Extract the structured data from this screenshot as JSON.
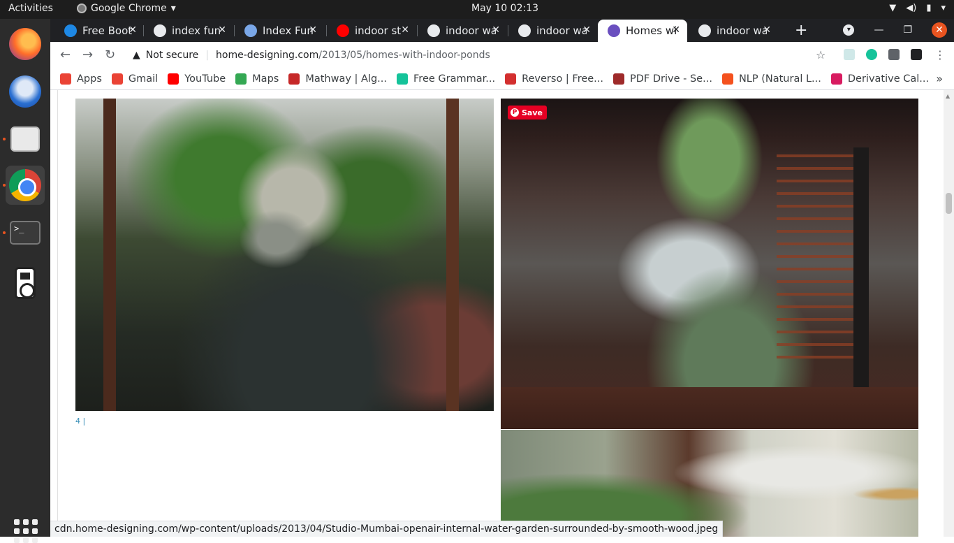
{
  "system": {
    "activities": "Activities",
    "app_name": "Google Chrome",
    "clock": "May 10  02:13"
  },
  "tabs": [
    {
      "title": "Free Boot",
      "icon_color": "#1e88e5",
      "active": false
    },
    {
      "title": "index fun",
      "icon_color": "#e8eaed",
      "active": false
    },
    {
      "title": "Index Fun",
      "icon_color": "#7aa7e8",
      "active": false
    },
    {
      "title": "indoor st",
      "icon_color": "#ff0000",
      "active": false
    },
    {
      "title": "indoor wa",
      "icon_color": "#e8eaed",
      "active": false
    },
    {
      "title": "indoor wa",
      "icon_color": "#e8eaed",
      "active": false
    },
    {
      "title": "Homes wi",
      "icon_color": "#6a4fbf",
      "active": true
    },
    {
      "title": "indoor wa",
      "icon_color": "#e8eaed",
      "active": false
    }
  ],
  "toolbar": {
    "security_label": "Not secure",
    "url_host": "home-designing.com",
    "url_path": "/2013/05/homes-with-indoor-ponds"
  },
  "bookmarks": [
    {
      "label": "Apps",
      "icon_color": "#ea4335"
    },
    {
      "label": "Gmail",
      "icon_color": "#ea4335"
    },
    {
      "label": "YouTube",
      "icon_color": "#ff0000"
    },
    {
      "label": "Maps",
      "icon_color": "#34a853"
    },
    {
      "label": "Mathway | Alg...",
      "icon_color": "#c62828"
    },
    {
      "label": "Free Grammar...",
      "icon_color": "#15c39a"
    },
    {
      "label": "Reverso | Free...",
      "icon_color": "#d32f2f"
    },
    {
      "label": "PDF Drive - Se...",
      "icon_color": "#9e2a2a"
    },
    {
      "label": "NLP (Natural L...",
      "icon_color": "#f4511e"
    },
    {
      "label": "Derivative Cal...",
      "icon_color": "#d81b60"
    }
  ],
  "page": {
    "caption": "4 |",
    "pin_save": "Save"
  },
  "status_url": "cdn.home-designing.com/wp-content/uploads/2013/04/Studio-Mumbai-openair-internal-water-garden-surrounded-by-smooth-wood.jpeg"
}
